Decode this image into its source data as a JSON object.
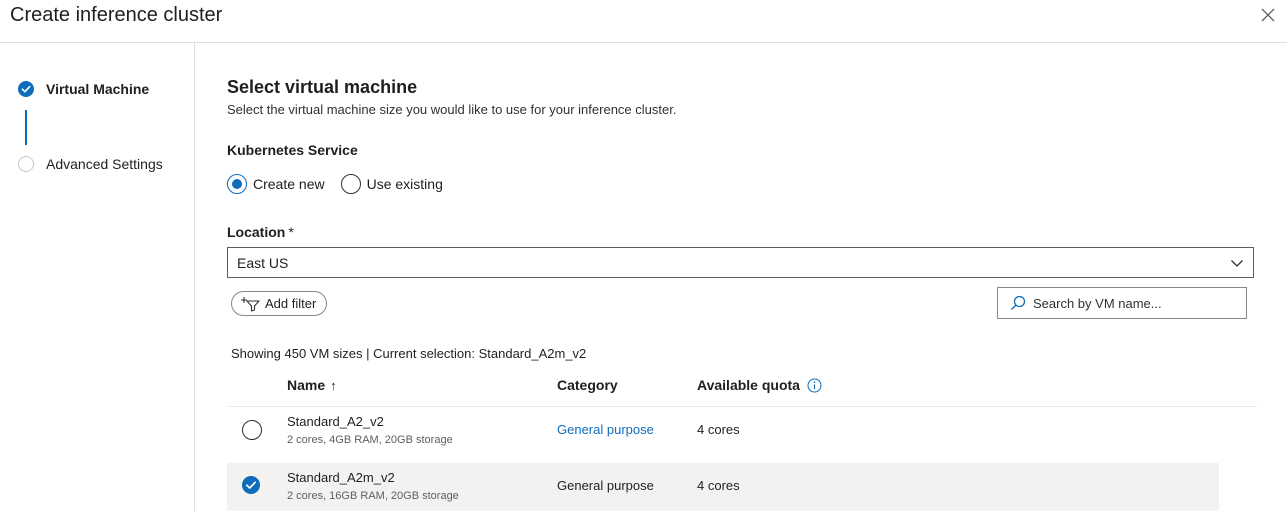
{
  "header": {
    "title": "Create inference cluster"
  },
  "steps": [
    {
      "label": "Virtual Machine",
      "state": "completed"
    },
    {
      "label": "Advanced Settings",
      "state": "pending"
    }
  ],
  "main": {
    "title": "Select virtual machine",
    "subtitle": "Select the virtual machine size you would like to use for your inference cluster.",
    "kubernetes": {
      "label": "Kubernetes Service",
      "options": [
        "Create new",
        "Use existing"
      ],
      "selected": "Create new"
    },
    "location": {
      "label": "Location",
      "required_mark": "*",
      "value": "East US"
    },
    "filter_button": "Add filter",
    "search": {
      "placeholder": "Search by VM name..."
    },
    "showing_text": "Showing 450 VM sizes | Current selection: Standard_A2m_v2",
    "table": {
      "columns": {
        "name": "Name",
        "category": "Category",
        "quota": "Available quota",
        "sort_indicator": "↑"
      },
      "rows": [
        {
          "name": "Standard_A2_v2",
          "specs": "2 cores, 4GB RAM, 20GB storage",
          "category": "General purpose",
          "quota": "4 cores",
          "selected": false
        },
        {
          "name": "Standard_A2m_v2",
          "specs": "2 cores, 16GB RAM, 20GB storage",
          "category": "General purpose",
          "quota": "4 cores",
          "selected": true
        }
      ]
    }
  },
  "colors": {
    "accent": "#0f6cbd",
    "selected_row": "#f3f2f1",
    "border": "#e1dfdd"
  },
  "icons": [
    "close-icon",
    "check-circle-icon",
    "chevron-down-icon",
    "add-filter-icon",
    "search-icon",
    "info-icon",
    "sort-ascending-icon"
  ]
}
